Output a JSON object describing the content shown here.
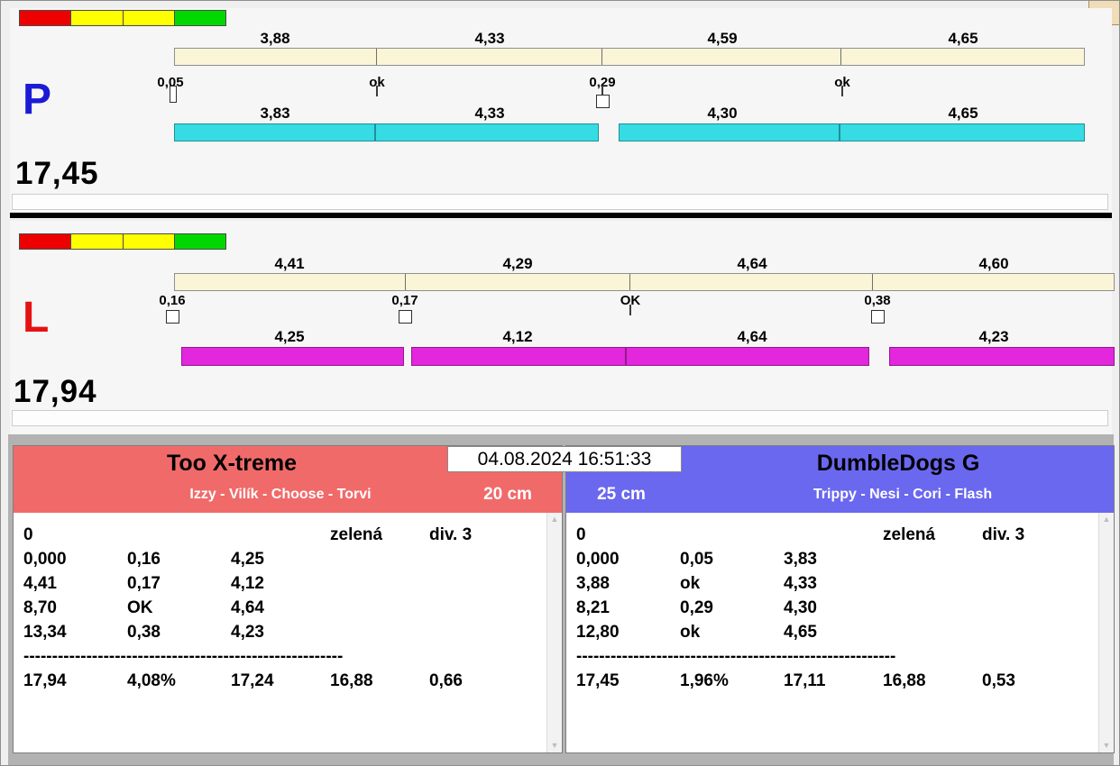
{
  "datetime": "04.08.2024 16:51:33",
  "lanes": {
    "p": {
      "label": "P",
      "total": "17,45",
      "top_values": [
        "3,88",
        "4,33",
        "4,59",
        "4,65"
      ],
      "markers": [
        "0,05",
        "ok",
        "0,29",
        "ok"
      ],
      "bottom_values": [
        "3,83",
        "4,33",
        "4,30",
        "4,65"
      ]
    },
    "l": {
      "label": "L",
      "total": "17,94",
      "top_values": [
        "4,41",
        "4,29",
        "4,64",
        "4,60"
      ],
      "markers": [
        "0,16",
        "0,17",
        "OK",
        "0,38"
      ],
      "bottom_values": [
        "4,25",
        "4,12",
        "4,64",
        "4,23"
      ]
    }
  },
  "teams": {
    "left": {
      "name": "Too X-treme",
      "dogs": "Izzy - Vilík - Choose - Torvi",
      "height": "20 cm",
      "rows": [
        [
          "0",
          "",
          "",
          "zelená",
          "div. 3"
        ],
        [
          "0,000",
          "0,16",
          "4,25",
          "",
          ""
        ],
        [
          "4,41",
          "0,17",
          "4,12",
          "",
          ""
        ],
        [
          "8,70",
          "OK",
          "4,64",
          "",
          ""
        ],
        [
          "13,34",
          "0,38",
          "4,23",
          "",
          ""
        ]
      ],
      "separator": "--------------------------------------------------------",
      "totals": [
        "17,94",
        "4,08%",
        "17,24",
        "16,88",
        "0,66"
      ]
    },
    "right": {
      "name": "DumbleDogs G",
      "dogs": "Trippy - Nesi - Cori - Flash",
      "height": "25 cm",
      "rows": [
        [
          "0",
          "",
          "",
          "zelená",
          "div. 3"
        ],
        [
          "0,000",
          "0,05",
          "3,83",
          "",
          ""
        ],
        [
          "3,88",
          "ok",
          "4,33",
          "",
          ""
        ],
        [
          "8,21",
          "0,29",
          "4,30",
          "",
          ""
        ],
        [
          "12,80",
          "ok",
          "4,65",
          "",
          ""
        ]
      ],
      "separator": "--------------------------------------------------------",
      "totals": [
        "17,45",
        "1,96%",
        "17,11",
        "16,88",
        "0,53"
      ]
    }
  },
  "scrollbar": {
    "up_icon": "▲",
    "down_icon": "▼"
  },
  "colors": {
    "status_segments": [
      "#EC0000",
      "#FFFF00",
      "#FFFF00",
      "#00D800"
    ],
    "plan_bar": "#FAF5D6",
    "p_run_bar": "#35DCE4",
    "l_run_bar": "#E227DD",
    "p_letter": "#1B1BD6",
    "l_letter": "#E51212",
    "left_header": "#F16A6A",
    "right_header": "#6A68EF"
  }
}
